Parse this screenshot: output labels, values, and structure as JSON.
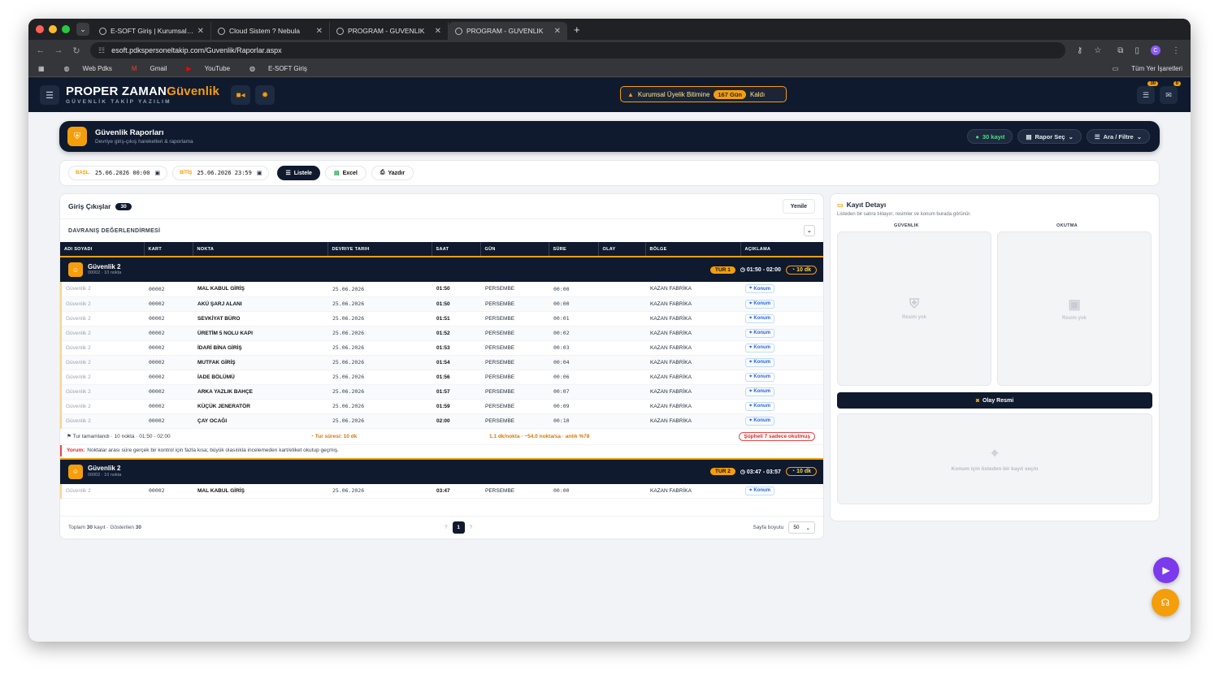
{
  "browser": {
    "tabs": [
      {
        "title": "E-SOFT Giriş | Kurumsal Platform",
        "active": false
      },
      {
        "title": "Cloud Sistem ? Nebula",
        "active": false
      },
      {
        "title": "PROGRAM - GUVENLIK",
        "active": false
      },
      {
        "title": "PROGRAM - GUVENLIK",
        "active": true
      }
    ],
    "url": "esoft.pdkspersoneltakip.com/Guvenlik/Raporlar.aspx",
    "profile_initial": "C",
    "bookmarks": [
      "Web Pdks",
      "Gmail",
      "YouTube",
      "E-SOFT Giriş"
    ],
    "all_bookmarks": "Tüm Yer İşaretleri"
  },
  "app": {
    "brand_main": "PROPER ZAMAN",
    "brand_accent": "Güvenlik",
    "brand_sub": "GÜVENLİK TAKİP YAZILIM",
    "alert_prefix": "Kurumsal Üyelik Bitimine",
    "alert_days": "167 Gün",
    "alert_suffix": "Kaldı",
    "badge_tasks": "30",
    "badge_mail": "0"
  },
  "section": {
    "title": "Güvenlik Raporları",
    "subtitle": "Devriye giriş-çıkış hareketleri & raporlama",
    "record_count": "30 kayıt",
    "report_select": "Rapor Seç",
    "search_filter": "Ara / Filtre"
  },
  "filters": {
    "start_label": "BAŞL.",
    "start_value": "25.06.2026 00:00",
    "end_label": "BİTİŞ",
    "end_value": "25.06.2026 23:59",
    "list_btn": "Listele",
    "excel_btn": "Excel",
    "print_btn": "Yazdır"
  },
  "list": {
    "title": "Giriş Çıkışlar",
    "count": "30",
    "refresh": "Yenile",
    "section_title": "DAVRANIŞ DEĞERLENDİRMESİ",
    "columns": [
      "ADI SOYADI",
      "KART",
      "NOKTA",
      "DEVRIYE TARIH",
      "SAAT",
      "GÜN",
      "SÜRE",
      "OLAY",
      "BÖLGE",
      "AÇIKLAMA"
    ],
    "group1": {
      "name": "Güvenlik 2",
      "sub": "00002 · 10 nokta",
      "tur": "TUR 1",
      "time": "01:50 - 02:00",
      "dk": "10 dk",
      "rows": [
        [
          "Güvenlik 2",
          "00002",
          "MAL KABUL GİRİŞ",
          "25.06.2026",
          "01:50",
          "PERSEMBE",
          "00:00",
          "",
          "KAZAN FABRİKA",
          "Konum"
        ],
        [
          "Güvenlik 2",
          "00002",
          "AKÜ ŞARJ ALANI",
          "25.06.2026",
          "01:50",
          "PERSEMBE",
          "00:00",
          "",
          "KAZAN FABRİKA",
          "Konum"
        ],
        [
          "Güvenlik 2",
          "00002",
          "SEVKİYAT BÜRO",
          "25.06.2026",
          "01:51",
          "PERSEMBE",
          "00:01",
          "",
          "KAZAN FABRİKA",
          "Konum"
        ],
        [
          "Güvenlik 2",
          "00002",
          "ÜRETİM 5 NOLU KAPI",
          "25.06.2026",
          "01:52",
          "PERSEMBE",
          "00:02",
          "",
          "KAZAN FABRİKA",
          "Konum"
        ],
        [
          "Güvenlik 2",
          "00002",
          "İDARİ BİNA GİRİŞ",
          "25.06.2026",
          "01:53",
          "PERSEMBE",
          "00:03",
          "",
          "KAZAN FABRİKA",
          "Konum"
        ],
        [
          "Güvenlik 2",
          "00002",
          "MUTFAK GİRİŞ",
          "25.06.2026",
          "01:54",
          "PERSEMBE",
          "00:04",
          "",
          "KAZAN FABRİKA",
          "Konum"
        ],
        [
          "Güvenlik 2",
          "00002",
          "İADE BÖLÜMÜ",
          "25.06.2026",
          "01:56",
          "PERSEMBE",
          "00:06",
          "",
          "KAZAN FABRİKA",
          "Konum"
        ],
        [
          "Güvenlik 2",
          "00002",
          "ARKA YAZLIK BAHÇE",
          "25.06.2026",
          "01:57",
          "PERSEMBE",
          "00:07",
          "",
          "KAZAN FABRİKA",
          "Konum"
        ],
        [
          "Güvenlik 2",
          "00002",
          "KÜÇÜK JENERATÖR",
          "25.06.2026",
          "01:59",
          "PERSEMBE",
          "00:09",
          "",
          "KAZAN FABRİKA",
          "Konum"
        ],
        [
          "Güvenlik 2",
          "00002",
          "ÇAY OCAĞI",
          "25.06.2026",
          "02:00",
          "PERSEMBE",
          "00:10",
          "",
          "KAZAN FABRİKA",
          "Konum"
        ]
      ],
      "summary_done": "Tur tamamlandı · 10 nokta · 01:50 - 02:00",
      "summary_duration": "Tur süresi: 10 dk",
      "summary_rate": "1.1 dk/nokta · ~54.0 nokta/sa · anlık %78",
      "summary_suspicious": "Şüpheli 7 sadece okutmuş",
      "comment_label": "Yorum:",
      "comment_text": "Noktalar arası süre gerçek bir kontrol için fazla kısa; büyük olasılıkla incelemeden kart/etiket okutup geçmiş."
    },
    "group2": {
      "name": "Güvenlik 2",
      "sub": "00002 · 10 nokta",
      "tur": "TUR 2",
      "time": "03:47 - 03:57",
      "dk": "10 dk",
      "rows": [
        [
          "Güvenlik 2",
          "00002",
          "MAL KABUL GİRİŞ",
          "25.06.2026",
          "03:47",
          "PERSEMBE",
          "00:00",
          "",
          "KAZAN FABRİKA",
          "Konum"
        ]
      ]
    },
    "footer_total_prefix": "Toplam",
    "footer_total": "30",
    "footer_total_mid": "kayıt · Gösterilen",
    "footer_shown": "30",
    "page_prev": "?",
    "page_current": "1",
    "page_next": "?",
    "page_size_label": "Sayfa boyutu",
    "page_size": "50"
  },
  "detail": {
    "title": "Kayıt Detayı",
    "subtitle": "Listeden bir satıra tıklayın; resimler ve konum burada görünür.",
    "col_guard": "GÜVENLIK",
    "col_read": "OKUTMA",
    "no_image": "Resim yok",
    "event_image": "Olay Resmi",
    "map_hint": "Konum için listeden bir kayıt seçin"
  },
  "colors": {
    "accent": "#f59e0b",
    "navy": "#0f1a2e",
    "danger": "#dc2626",
    "fab_purple": "#7c3aed"
  }
}
